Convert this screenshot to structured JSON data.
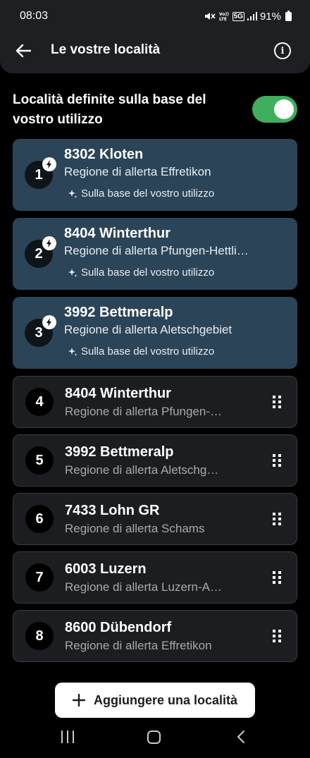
{
  "status_bar": {
    "time": "08:03",
    "volte_label": "Vo))\nLTE",
    "network_label": "5G",
    "battery": "91%"
  },
  "header": {
    "title": "Le vostre località",
    "back_icon": "arrow-left-icon",
    "info_icon": "info-icon"
  },
  "auto_locations": {
    "label": "Località definite sulla base del vostro utilizzo",
    "enabled": true,
    "accent": "#3fae5d"
  },
  "locations": [
    {
      "number": "1",
      "name": "8302 Kloten",
      "region": "Regione di allerta Effretikon",
      "usage": "Sulla base del vostro utilizzo",
      "auto": true
    },
    {
      "number": "2",
      "name": "8404 Winterthur",
      "region": "Regione di allerta Pfungen-Hettli…",
      "usage": "Sulla base del vostro utilizzo",
      "auto": true
    },
    {
      "number": "3",
      "name": "3992 Bettmeralp",
      "region": "Regione di allerta Aletschgebiet",
      "usage": "Sulla base del vostro utilizzo",
      "auto": true
    },
    {
      "number": "4",
      "name": "8404 Winterthur",
      "region": "Regione di allerta Pfungen-…",
      "auto": false
    },
    {
      "number": "5",
      "name": "3992 Bettmeralp",
      "region": "Regione di allerta Aletschg…",
      "auto": false
    },
    {
      "number": "6",
      "name": "7433 Lohn GR",
      "region": "Regione di allerta Schams",
      "auto": false
    },
    {
      "number": "7",
      "name": "6003 Luzern",
      "region": "Regione di allerta Luzern-A…",
      "auto": false
    },
    {
      "number": "8",
      "name": "8600 Dübendorf",
      "region": "Regione di allerta Effretikon",
      "auto": false
    }
  ],
  "add_button": {
    "label": "Aggiungere una località",
    "icon": "plus-icon"
  },
  "colors": {
    "auto_card": "#2c4457",
    "manual_card": "#1c1d20",
    "header": "#1e1f22"
  }
}
